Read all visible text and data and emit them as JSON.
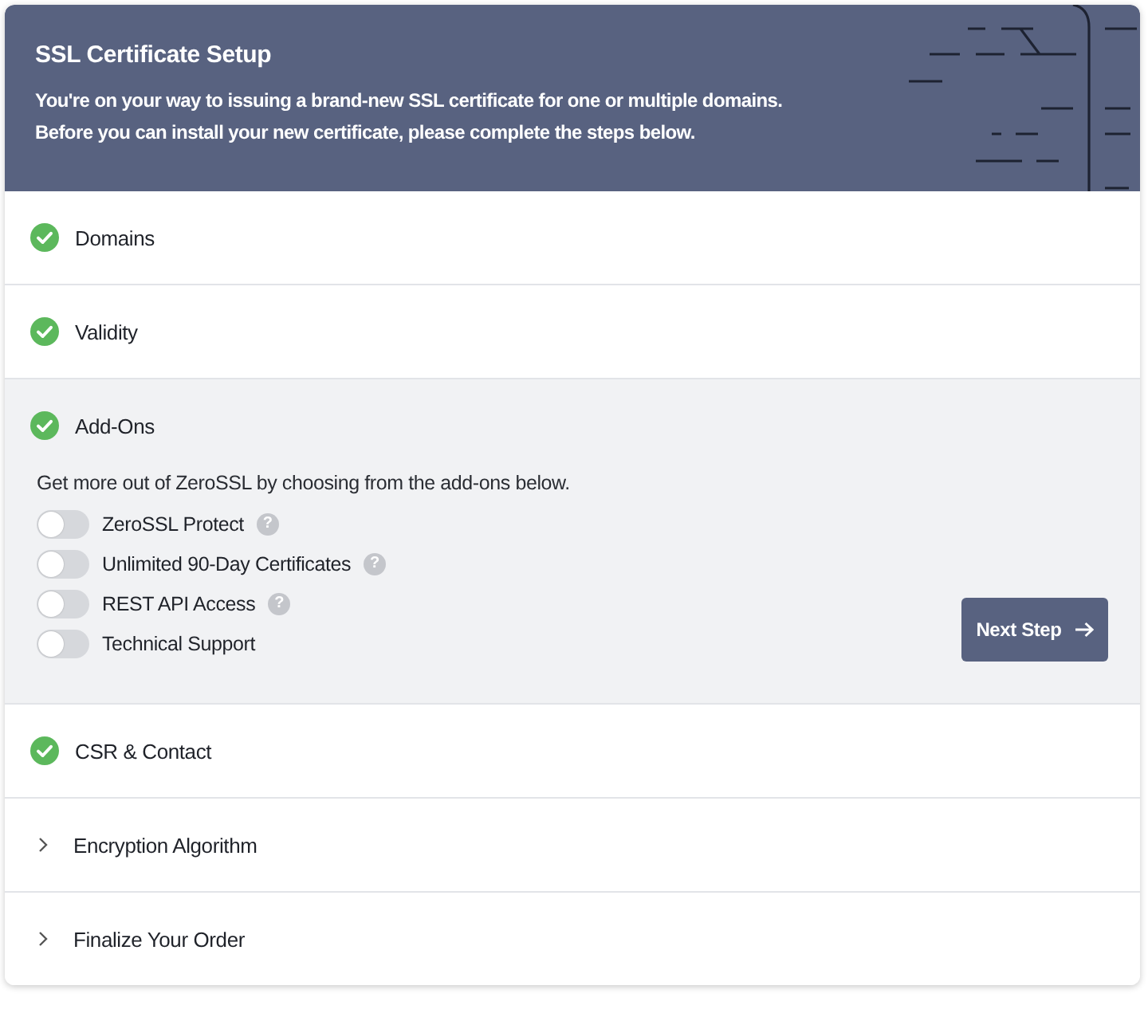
{
  "header": {
    "title": "SSL Certificate Setup",
    "description_lines": [
      "You're on your way to issuing a brand-new SSL certificate for one or multiple domains.",
      "Before you can install your new certificate, please complete the steps below."
    ]
  },
  "steps": [
    {
      "label": "Domains",
      "completed": true,
      "expanded": false
    },
    {
      "label": "Validity",
      "completed": true,
      "expanded": false
    },
    {
      "label": "Add-Ons",
      "completed": true,
      "expanded": true,
      "intro": "Get more out of ZeroSSL by choosing from the add-ons below.",
      "addons": [
        {
          "label": "ZeroSSL Protect",
          "on": false,
          "help": "?"
        },
        {
          "label": "Unlimited 90-Day Certificates",
          "on": false,
          "help": "?"
        },
        {
          "label": "REST API Access",
          "on": false,
          "help": "?"
        },
        {
          "label": "Technical Support",
          "on": false
        }
      ],
      "button": "Next Step"
    },
    {
      "label": "CSR & Contact",
      "completed": true,
      "expanded": false
    },
    {
      "label": "Encryption Algorithm",
      "completed": false,
      "expanded": false
    },
    {
      "label": "Finalize Your Order",
      "completed": false,
      "expanded": false
    }
  ]
}
